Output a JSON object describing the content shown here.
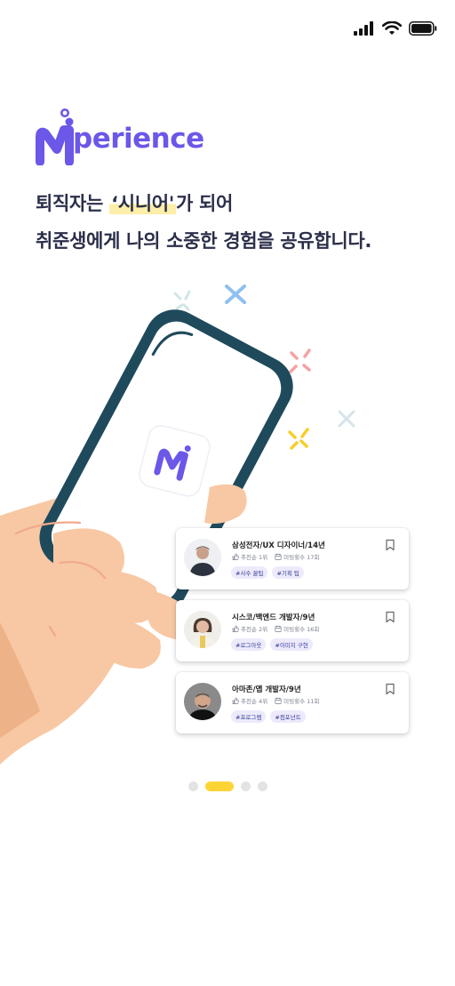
{
  "logo": {
    "text": "perience"
  },
  "headline": {
    "line1_pre": "퇴직자는 ",
    "line1_highlight": "‘시니어'",
    "line1_post": "가 되어",
    "line2": "취준생에게 나의 소중한 경험을 공유합니다."
  },
  "cards": [
    {
      "title": "삼성전자/UX 디자이너/14년",
      "recommend": "추천순 1위",
      "meetings": "미팅횟수 17회",
      "tags": [
        "#사수 꿀팁",
        "#기획 팁"
      ]
    },
    {
      "title": "시스코/백엔드 개발자/9년",
      "recommend": "추천순 2위",
      "meetings": "미팅횟수 16회",
      "tags": [
        "#로그아웃",
        "#이미지 구현"
      ]
    },
    {
      "title": "아마존/앱 개발자/9년",
      "recommend": "추천순 4위",
      "meetings": "미팅횟수 11회",
      "tags": [
        "#프로그램",
        "#컴포넌트"
      ]
    }
  ],
  "pagination": {
    "count": 4,
    "active": 2
  },
  "colors": {
    "brand": "#6b57e8",
    "highlight": "#fdeea9",
    "active_dot": "#fcd435",
    "phone_frame": "#1f4a5c",
    "hand": "#f7c8a3"
  }
}
